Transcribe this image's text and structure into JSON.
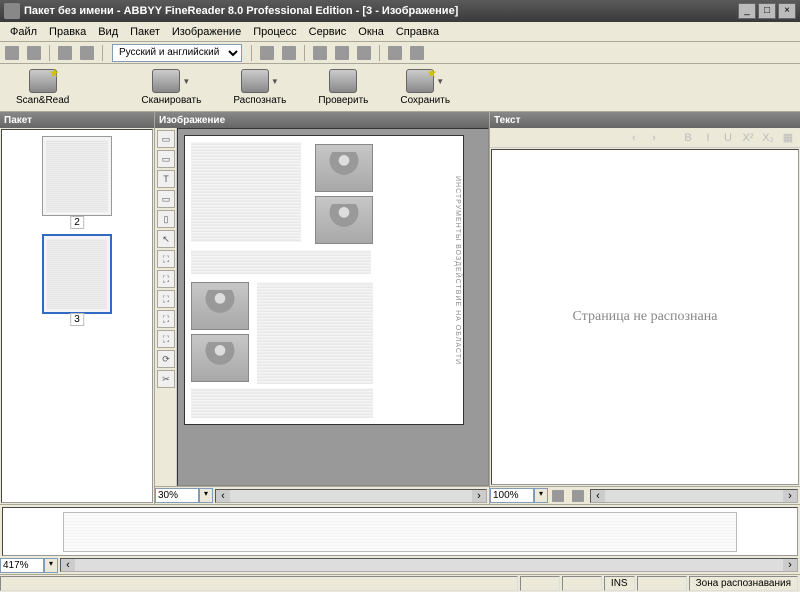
{
  "window": {
    "title": "Пакет без имени - ABBYY FineReader 8.0 Professional Edition - [3 - Изображение]",
    "min": "_",
    "max": "□",
    "close": "×"
  },
  "menu": [
    "Файл",
    "Правка",
    "Вид",
    "Пакет",
    "Изображение",
    "Процесс",
    "Сервис",
    "Окна",
    "Справка"
  ],
  "toolbar1": {
    "language_selected": "Русский и английский"
  },
  "toolbar2": {
    "scan_read": "Scan&Read",
    "scan": "Сканировать",
    "recognize": "Распознать",
    "check": "Проверить",
    "save": "Сохранить"
  },
  "panels": {
    "batch": "Пакет",
    "image": "Изображение",
    "text": "Текст"
  },
  "thumbs": {
    "page2": "2",
    "page3": "3"
  },
  "image_tools": [
    "▭",
    "▭",
    "T",
    "▭",
    "▯",
    "↖",
    "⛶",
    "⛶",
    "⛶",
    "⛶",
    "⛶",
    "⟳",
    "✂"
  ],
  "zoom": {
    "image_zoom": "30%",
    "text_zoom": "100%",
    "magnifier_zoom": "417%"
  },
  "text_placeholder": "Страница не распознана",
  "text_toolbar_icons": [
    "B",
    "I",
    "U",
    "X²",
    "X₂",
    "▦"
  ],
  "statusbar": {
    "ins": "INS",
    "zone": "Зона распознавания"
  },
  "page_sidetext": "ИНСТРУМЕНТЫ  ВОЗДЕЙСТВИЕ НА ОБЛАСТИ"
}
